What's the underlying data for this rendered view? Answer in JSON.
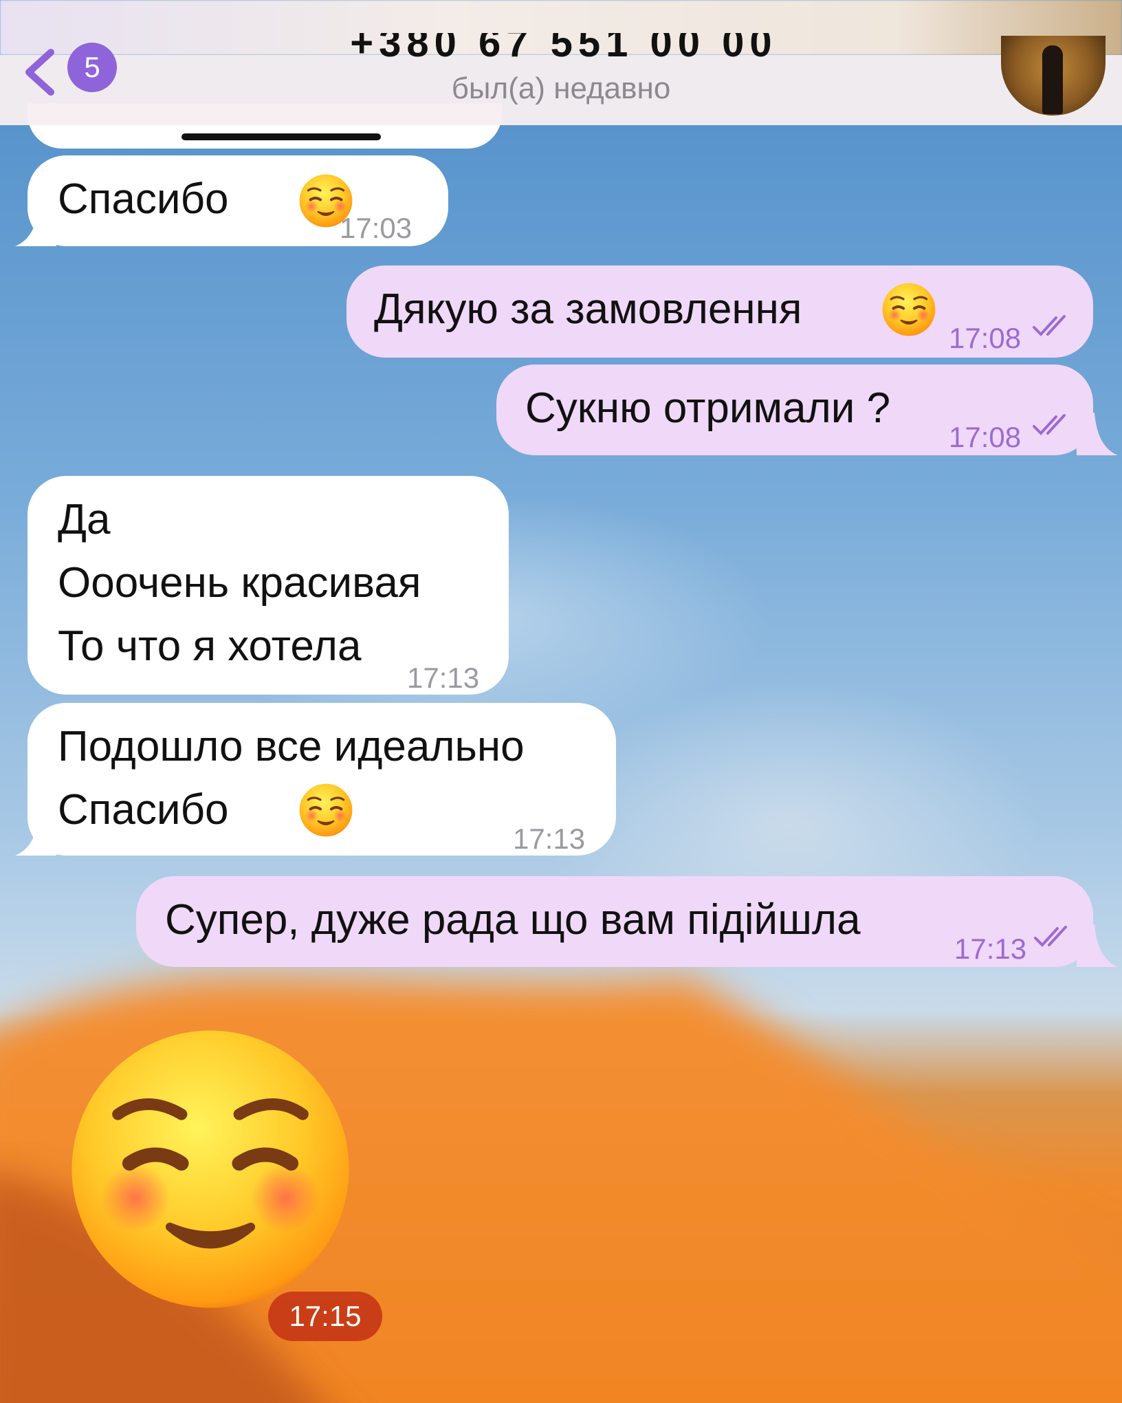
{
  "header": {
    "unread_count": "5",
    "contact_name": "+380 67 551 00 00",
    "status": "был(а) недавно"
  },
  "messages": [
    {
      "direction": "in",
      "text": "Спасибо",
      "emoji": "smiling-face-icon",
      "time": "17:03"
    },
    {
      "direction": "out",
      "text": "Дякую за замовлення",
      "emoji": "smiling-face-icon",
      "time": "17:08",
      "status": "read"
    },
    {
      "direction": "out",
      "text": "Сукню отримали ?",
      "time": "17:08",
      "status": "read"
    },
    {
      "direction": "in",
      "lines": [
        "Да",
        "Ооочень красивая",
        "То что я хотела"
      ],
      "time": "17:13"
    },
    {
      "direction": "in",
      "lines": [
        "Подошло все идеально",
        "Спасибо"
      ],
      "emoji": "smiling-face-icon",
      "time": "17:13"
    },
    {
      "direction": "out",
      "text": "Супер, дуже рада що вам підійшла",
      "time": "17:13",
      "status": "read"
    },
    {
      "direction": "in",
      "type": "sticker",
      "emoji": "smiling-face-icon",
      "time": "17:15"
    }
  ],
  "colors": {
    "incoming_bubble": "#ffffff",
    "outgoing_bubble": "#f0d8f8",
    "accent": "#8f63d9",
    "outgoing_time": "#9b6bd2"
  }
}
